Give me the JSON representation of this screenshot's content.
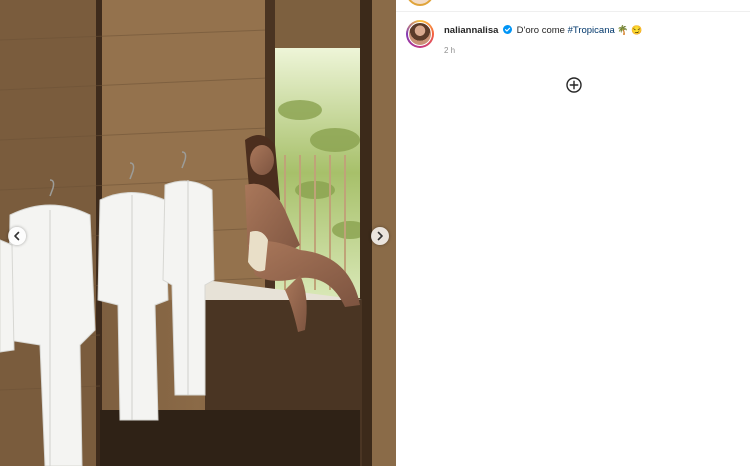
{
  "post": {
    "username": "naliannalisa",
    "caption_text": "D'oro come ",
    "hashtag": "#Tropicana",
    "emojis": "🌴 😏",
    "time": "2 h"
  },
  "icons": {
    "prev": "chevron-left-icon",
    "next": "chevron-right-icon",
    "verified": "verified-badge-icon",
    "add": "add-circle-icon"
  },
  "colors": {
    "hashtag": "#00376b",
    "verified": "#0095f6",
    "muted": "#8e8e8e"
  }
}
